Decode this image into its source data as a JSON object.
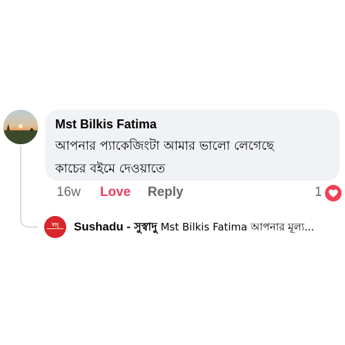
{
  "comment": {
    "author": "Mst Bilkis Fatima",
    "text_line1": "আপনার প্যাকেজিংটা আমার ভালো লেগেছে",
    "text_line2": "কাচের বইমে দেওয়াতে",
    "time": "16w",
    "love_label": "Love",
    "reply_label": "Reply",
    "reaction_count": "1",
    "reaction_icon": "heart-icon",
    "reaction_color": "#f33e58"
  },
  "reply_preview": {
    "author_en": "Sushadu -",
    "author_bn": "সুস্বাদু",
    "text": "Mst Bilkis Fatima আপনার মূল্য...",
    "avatar_text": "স্বাদু",
    "avatar_color": "#d8262c"
  }
}
